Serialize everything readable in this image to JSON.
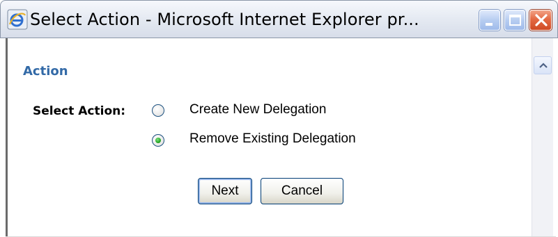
{
  "window": {
    "title": "Select Action - Microsoft Internet Explorer pr...",
    "icon": "internet-explorer-icon",
    "controls": [
      "minimize-icon",
      "maximize-icon",
      "close-icon"
    ]
  },
  "section": {
    "title": "Action"
  },
  "form": {
    "label": "Select Action:",
    "options": [
      {
        "label": "Create New Delegation",
        "selected": false
      },
      {
        "label": "Remove Existing Delegation",
        "selected": true
      }
    ]
  },
  "buttons": {
    "next_label": "Next",
    "cancel_label": "Cancel"
  },
  "colors": {
    "section_title": "#336aa7",
    "radio_selected": "#26a626",
    "button_border": "#003c74"
  }
}
